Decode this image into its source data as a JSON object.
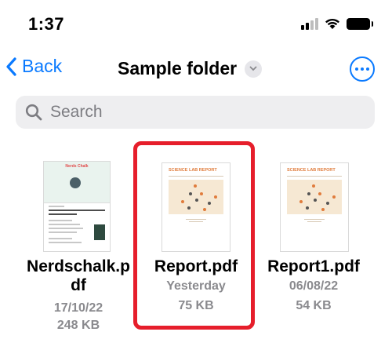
{
  "status_bar": {
    "time": "1:37",
    "icons": [
      "signal-icon",
      "wifi-icon",
      "battery-icon"
    ]
  },
  "nav": {
    "back_label": "Back",
    "title": "Sample folder",
    "more_icon": "ellipsis-circle-icon"
  },
  "search": {
    "placeholder": "Search",
    "value": ""
  },
  "files": [
    {
      "name_line1": "Nerdschalk.p",
      "name_line2": "df",
      "date": "17/10/22",
      "size": "248 KB",
      "thumb_logo": "Nerds Chalk"
    },
    {
      "name_line1": "Report.pdf",
      "date": "Yesterday",
      "size": "75 KB",
      "thumb_title": "SCIENCE LAB REPORT"
    },
    {
      "name_line1": "Report1.pdf",
      "date": "06/08/22",
      "size": "54 KB",
      "thumb_title": "SCIENCE LAB REPORT"
    }
  ],
  "colors": {
    "accent": "#0a7aff",
    "highlight": "#e61e2b",
    "secondary_text": "#8a8a8e"
  }
}
